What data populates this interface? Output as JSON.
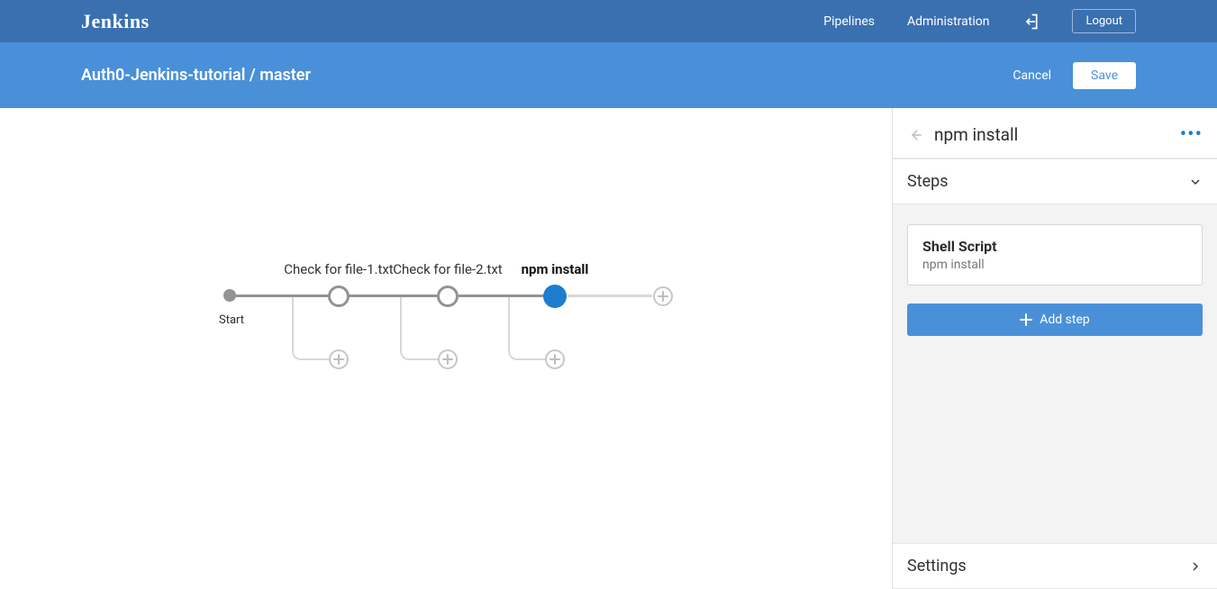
{
  "brand": "Jenkins",
  "nav": {
    "pipelines": "Pipelines",
    "administration": "Administration",
    "logout": "Logout"
  },
  "breadcrumb": "Auth0-Jenkins-tutorial / master",
  "actions": {
    "cancel": "Cancel",
    "save": "Save"
  },
  "graph": {
    "start_label": "Start",
    "stages": [
      {
        "label": "Check for file-1.txt",
        "selected": false
      },
      {
        "label": "Check for file-2.txt",
        "selected": false
      },
      {
        "label": "npm install",
        "selected": true
      }
    ]
  },
  "panel": {
    "title": "npm install",
    "steps_heading": "Steps",
    "step": {
      "title": "Shell Script",
      "subtitle": "npm install"
    },
    "add_step": "Add step",
    "settings_heading": "Settings"
  }
}
